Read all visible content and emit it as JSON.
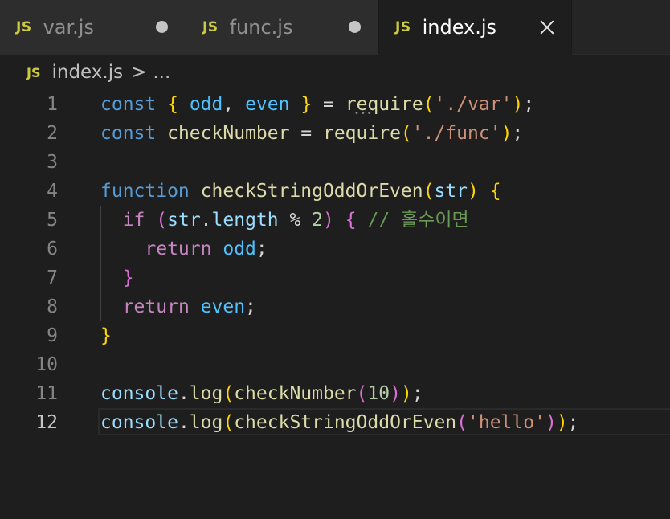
{
  "tabs": [
    {
      "badge": "JS",
      "label": "var.js",
      "state": "unsaved"
    },
    {
      "badge": "JS",
      "label": "func.js",
      "state": "unsaved"
    },
    {
      "badge": "JS",
      "label": "index.js",
      "state": "active"
    }
  ],
  "breadcrumb": {
    "badge": "JS",
    "file": "index.js",
    "separator": ">",
    "more": "..."
  },
  "colors": {
    "keyword": "#569cd6",
    "control": "#c586c0",
    "variable": "#9cdcfe",
    "constant": "#4fc1ff",
    "function": "#dcdcaa",
    "string": "#ce9178",
    "number": "#b5cea8",
    "comment": "#6a9955",
    "bracket_1": "#ffd700",
    "bracket_2": "#da70d6",
    "bracket_3": "#179fff",
    "js_badge": "#cbcb41"
  },
  "editor": {
    "active_line": 12,
    "lines": [
      {
        "n": "1",
        "tokens": [
          [
            "kw",
            "const"
          ],
          [
            "pl",
            " "
          ],
          [
            "br1",
            "{"
          ],
          [
            "pl",
            " "
          ],
          [
            "cst",
            "odd"
          ],
          [
            "pl",
            ", "
          ],
          [
            "cst",
            "even"
          ],
          [
            "pl",
            " "
          ],
          [
            "br1",
            "}"
          ],
          [
            "pl",
            " = "
          ],
          [
            "fn",
            "require"
          ],
          [
            "br1",
            "("
          ],
          [
            "str",
            "'./var'"
          ],
          [
            "br1",
            ")"
          ],
          [
            "pl",
            ";"
          ]
        ]
      },
      {
        "n": "2",
        "tokens": [
          [
            "kw",
            "const"
          ],
          [
            "pl",
            " "
          ],
          [
            "fn",
            "checkNumber"
          ],
          [
            "pl",
            " = "
          ],
          [
            "fn",
            "require"
          ],
          [
            "br1",
            "("
          ],
          [
            "str",
            "'./func'"
          ],
          [
            "br1",
            ")"
          ],
          [
            "pl",
            ";"
          ]
        ]
      },
      {
        "n": "3",
        "tokens": []
      },
      {
        "n": "4",
        "tokens": [
          [
            "kw",
            "function"
          ],
          [
            "pl",
            " "
          ],
          [
            "fn",
            "checkStringOddOrEven"
          ],
          [
            "br1",
            "("
          ],
          [
            "var",
            "str"
          ],
          [
            "br1",
            ")"
          ],
          [
            "pl",
            " "
          ],
          [
            "br1",
            "{"
          ]
        ]
      },
      {
        "n": "5",
        "tokens": [
          [
            "pl",
            "  "
          ],
          [
            "ctl",
            "if"
          ],
          [
            "pl",
            " "
          ],
          [
            "br2",
            "("
          ],
          [
            "var",
            "str"
          ],
          [
            "pl",
            "."
          ],
          [
            "var",
            "length"
          ],
          [
            "pl",
            " % "
          ],
          [
            "num",
            "2"
          ],
          [
            "br2",
            ")"
          ],
          [
            "pl",
            " "
          ],
          [
            "br2",
            "{"
          ],
          [
            "pl",
            " "
          ],
          [
            "cmt",
            "// 홀수이면"
          ]
        ]
      },
      {
        "n": "6",
        "tokens": [
          [
            "pl",
            "    "
          ],
          [
            "ctl",
            "return"
          ],
          [
            "pl",
            " "
          ],
          [
            "cst",
            "odd"
          ],
          [
            "pl",
            ";"
          ]
        ]
      },
      {
        "n": "7",
        "tokens": [
          [
            "pl",
            "  "
          ],
          [
            "br2",
            "}"
          ]
        ]
      },
      {
        "n": "8",
        "tokens": [
          [
            "pl",
            "  "
          ],
          [
            "ctl",
            "return"
          ],
          [
            "pl",
            " "
          ],
          [
            "cst",
            "even"
          ],
          [
            "pl",
            ";"
          ]
        ]
      },
      {
        "n": "9",
        "tokens": [
          [
            "br1",
            "}"
          ]
        ]
      },
      {
        "n": "10",
        "tokens": []
      },
      {
        "n": "11",
        "tokens": [
          [
            "var",
            "console"
          ],
          [
            "pl",
            "."
          ],
          [
            "fn",
            "log"
          ],
          [
            "br1",
            "("
          ],
          [
            "fn",
            "checkNumber"
          ],
          [
            "br2",
            "("
          ],
          [
            "num",
            "10"
          ],
          [
            "br2",
            ")"
          ],
          [
            "br1",
            ")"
          ],
          [
            "pl",
            ";"
          ]
        ]
      },
      {
        "n": "12",
        "tokens": [
          [
            "var",
            "console"
          ],
          [
            "pl",
            "."
          ],
          [
            "fn",
            "log"
          ],
          [
            "br1",
            "("
          ],
          [
            "fn",
            "checkStringOddOrEven"
          ],
          [
            "br2",
            "("
          ],
          [
            "str",
            "'hello'"
          ],
          [
            "br2",
            ")"
          ],
          [
            "br1",
            ")"
          ],
          [
            "pl",
            ";"
          ]
        ]
      }
    ]
  }
}
